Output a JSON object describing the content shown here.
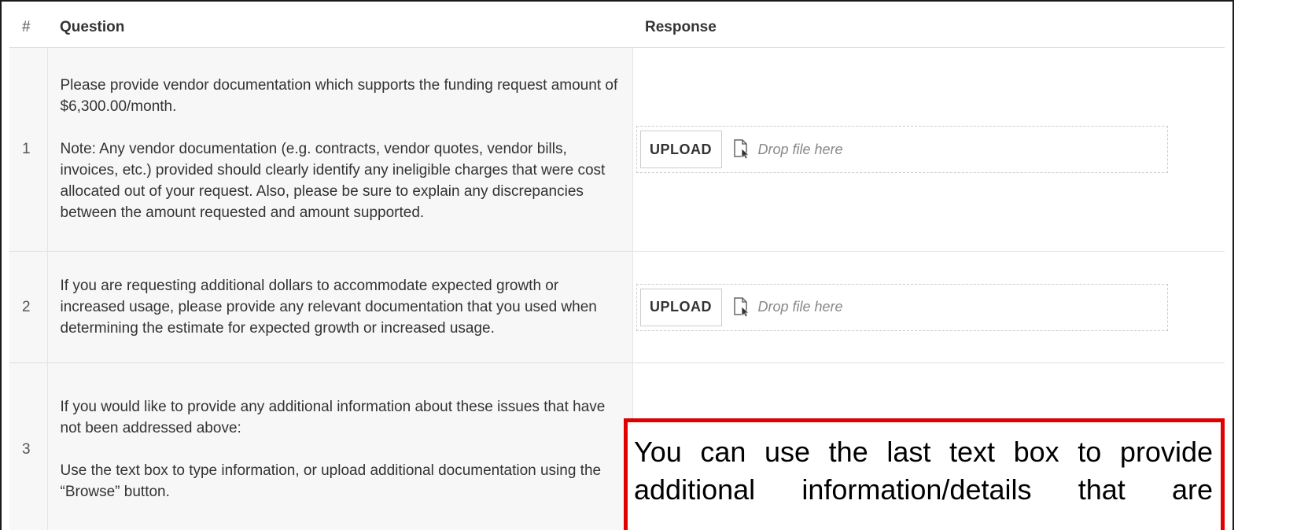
{
  "table": {
    "headers": {
      "num": "#",
      "question": "Question",
      "response": "Response"
    },
    "rows": [
      {
        "num": "1",
        "question_paragraphs": [
          "Please provide vendor documentation which supports the funding request amount of $6,300.00/month.",
          "Note: Any vendor documentation (e.g. contracts, vendor quotes, vendor bills, invoices, etc.) provided should clearly identify any ineligible charges that were cost allocated out of your request. Also, please be sure to explain any discrepancies between the amount requested and amount supported."
        ],
        "upload_label": "UPLOAD",
        "drop_placeholder": "Drop file here"
      },
      {
        "num": "2",
        "question_paragraphs": [
          "If you are requesting additional dollars to accommodate expected growth or increased usage, please provide any relevant documentation that you used when determining the estimate for expected growth or increased usage."
        ],
        "upload_label": "UPLOAD",
        "drop_placeholder": "Drop file here"
      },
      {
        "num": "3",
        "question_paragraphs": [
          "If you would like to provide any additional information about these issues that have not been addressed above:",
          "Use the text box to type information, or upload additional documentation using the “Browse” button."
        ]
      }
    ]
  },
  "callout": {
    "text": "You can use the last text box to provide additional information/details that are",
    "border_color": "#e00000"
  },
  "icons": {
    "drop": "file-drop-icon"
  }
}
